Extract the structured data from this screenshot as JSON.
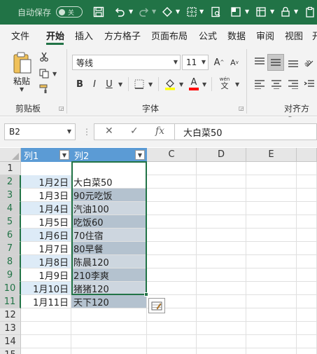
{
  "titlebar": {
    "autosave_label": "自动保存",
    "autosave_state": "关"
  },
  "tabs": [
    {
      "label": "文件"
    },
    {
      "label": "开始",
      "active": true
    },
    {
      "label": "插入"
    },
    {
      "label": "方方格子"
    },
    {
      "label": "页面布局"
    },
    {
      "label": "公式"
    },
    {
      "label": "数据"
    },
    {
      "label": "审阅"
    },
    {
      "label": "视图"
    },
    {
      "label": "开"
    }
  ],
  "ribbon": {
    "paste_label": "粘贴",
    "clipboard_group": "剪贴板",
    "font_group": "字体",
    "align_group": "对齐方式",
    "font_name": "等线",
    "font_size": "11",
    "bold": "B",
    "italic": "I",
    "underline": "U",
    "phonetic": "wén",
    "font_color": "A",
    "grow_font": "A",
    "shrink_font": "A"
  },
  "formula_bar": {
    "name_box": "B2",
    "fx": "fx",
    "content": "大白菜50"
  },
  "columns": [
    {
      "label": "A",
      "header": "列1"
    },
    {
      "label": "B",
      "header": "列2"
    },
    {
      "label": "C"
    },
    {
      "label": "D"
    },
    {
      "label": "E"
    }
  ],
  "rows": [
    "1",
    "2",
    "3",
    "4",
    "5",
    "6",
    "7",
    "8",
    "9",
    "10",
    "11",
    "12",
    "13",
    "14",
    "15"
  ],
  "table": {
    "col1": [
      "1月2日",
      "1月3日",
      "1月4日",
      "1月5日",
      "1月6日",
      "1月7日",
      "1月8日",
      "1月9日",
      "1月10日",
      "1月11日"
    ],
    "col2": [
      "大白菜50",
      "90元吃饭",
      "汽油100",
      "吃饭60",
      "70住宿",
      "80早餐",
      "陈晨120",
      "210李爽",
      "猪猪120",
      "天下120"
    ]
  },
  "colors": {
    "brand": "#217346",
    "table_header": "#5b9bd5",
    "band_light": "#ddebf7",
    "band_sel_light": "#cdd6df",
    "band_sel_dark": "#b4c2cf"
  }
}
